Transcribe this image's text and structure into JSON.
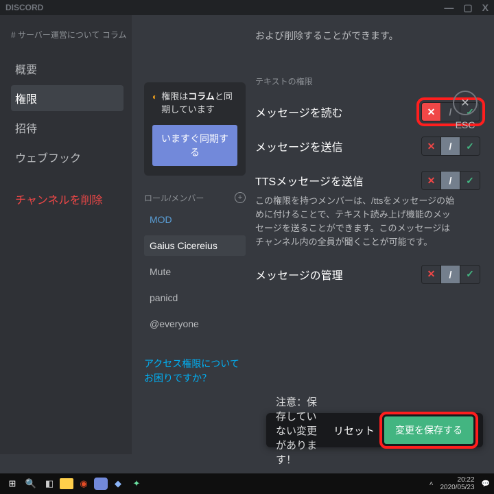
{
  "titlebar": {
    "brand": "DISCORD",
    "min": "—",
    "max": "▢",
    "close": "X"
  },
  "esc": {
    "glyph": "✕",
    "label": "ESC"
  },
  "sidebar": {
    "heading": "# サーバー運営について  コラム",
    "items": [
      {
        "label": "概要"
      },
      {
        "label": "権限"
      },
      {
        "label": "招待"
      },
      {
        "label": "ウェブフック"
      }
    ],
    "delete_label": "チャンネルを削除"
  },
  "sync": {
    "prefix": "権限は",
    "category": "コラム",
    "suffix": "と同期しています",
    "button": "いますぐ同期する"
  },
  "roles": {
    "heading": "ロール/メンバー",
    "items": [
      "MOD",
      "Gaius Cicereius",
      "Mute",
      "panicd",
      "@everyone"
    ],
    "selected_index": 1,
    "help": "アクセス権限についてお困りですか？"
  },
  "perms": {
    "truncated_top": "および削除することができます。",
    "section": "テキストの権限",
    "rows": [
      {
        "label": "メッセージを読む",
        "state": "deny",
        "highlight": true
      },
      {
        "label": "メッセージを送信",
        "state": "pass",
        "highlight": false
      },
      {
        "label": "TTSメッセージを送信",
        "state": "pass",
        "highlight": false,
        "desc": "この権限を持つメンバーは、/ttsをメッセージの始めに付けることで、テキスト読み上げ機能のメッセージを送ることができます。このメッセージはチャンネル内の全員が聞くことが可能です。"
      },
      {
        "label": "メッセージの管理",
        "state": "pass",
        "highlight": false
      }
    ]
  },
  "unsaved": {
    "msg": "注意：保存していない変更があります！",
    "reset": "リセット",
    "save": "変更を保存する"
  },
  "taskbar": {
    "time": "20:22",
    "date": "2020/05/23"
  }
}
